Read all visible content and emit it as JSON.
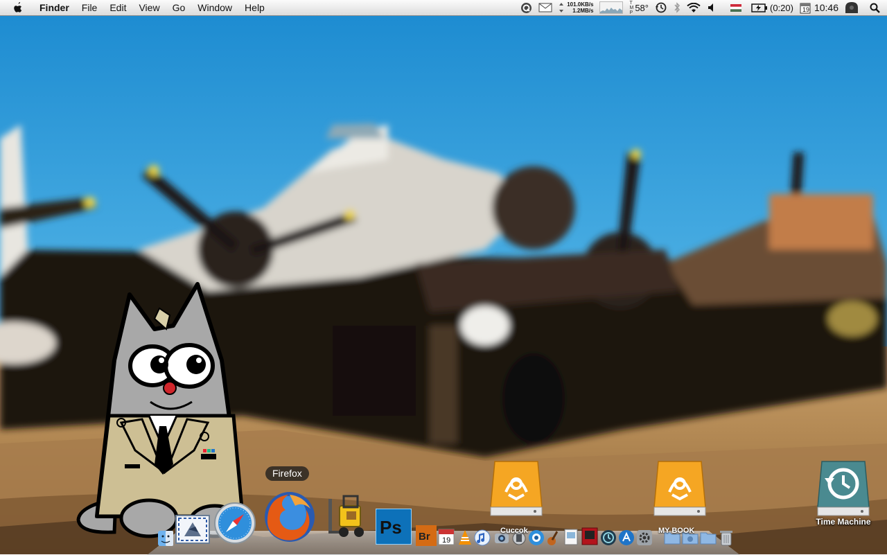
{
  "menubar": {
    "app_name": "Finder",
    "menus": [
      "File",
      "Edit",
      "View",
      "Go",
      "Window",
      "Help"
    ],
    "status": {
      "net_down": "101.0KB/s",
      "net_up": "1.2MB/s",
      "temperature": "58°",
      "battery_time": "(0:20)",
      "calendar_day": "19",
      "clock": "10:46"
    }
  },
  "desktop": {
    "icons": [
      {
        "label": ""
      },
      {
        "label": ""
      },
      {
        "label": "Time Machine"
      }
    ]
  },
  "dock": {
    "tooltip": "Firefox",
    "folder_labels": [
      "Cuccok",
      "MY BOOK"
    ],
    "icons": [
      "finder-icon",
      "mail-icon",
      "safari-icon",
      "firefox-icon",
      "forklift-icon",
      "photoshop-icon",
      "bridge-icon",
      "ical-icon",
      "vlc-icon",
      "itunes-icon",
      "iphoto-icon",
      "automator-icon",
      "app-icon",
      "guitar-icon",
      "preview-icon",
      "photobooth-icon",
      "time-machine-icon",
      "app-store-icon",
      "settings-icon",
      "folder-icon",
      "trash-icon"
    ]
  },
  "colors": {
    "sky": "#3fa4dc",
    "ground": "#b0875a",
    "drive_orange": "#f5a623",
    "time_machine_teal": "#4a8a90"
  }
}
